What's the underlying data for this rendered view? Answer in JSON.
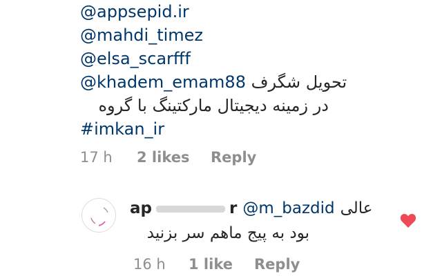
{
  "comment": {
    "mentions": [
      "@appsepid.ir",
      "@mahdi_timez",
      "@elsa_scarfff"
    ],
    "mention_last": "@khadem_emam88",
    "persian_line_1": "تحویل شگرف",
    "persian_line_2": "در زمینه دیجیتال مارکتینگ با گروه",
    "hashtag": "#imkan_ir",
    "time": "17 h",
    "likes": "2 likes",
    "reply_label": "Reply"
  },
  "reply": {
    "username_start": "ap",
    "username_end": "r",
    "mention": "@m_bazdid",
    "persian_line_1": "عالی",
    "persian_line_2": "بود به پیج ماهم سر بزنید",
    "time": "16 h",
    "likes": "1 like",
    "reply_label": "Reply",
    "heart_color": "#ed4956"
  }
}
